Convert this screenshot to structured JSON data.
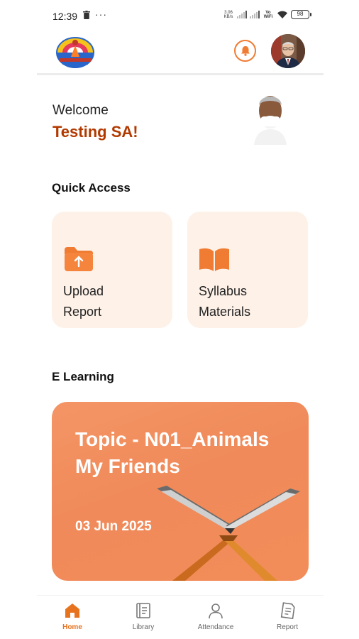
{
  "status_bar": {
    "time": "12:39",
    "more": "···",
    "net_speed_top": "3.06",
    "net_speed_bottom": "KB/s",
    "volte_top": "Vo",
    "volte_bottom": "WiFi",
    "battery": "98"
  },
  "header": {
    "logo_icon": "school-logo",
    "bell_icon": "bell-icon",
    "avatar": "profile-avatar"
  },
  "welcome": {
    "greeting": "Welcome",
    "name": "Testing SA!"
  },
  "quick_access": {
    "title": "Quick Access",
    "items": [
      {
        "line1": "Upload",
        "line2": "Report",
        "icon": "folder-upload-icon"
      },
      {
        "line1": "Syllabus",
        "line2": "Materials",
        "icon": "open-book-icon"
      }
    ]
  },
  "e_learning": {
    "title": "E Learning",
    "topic_line1": "Topic - N01_Animals",
    "topic_line2": "My Friends",
    "date": "03 Jun 2025"
  },
  "bottom_nav": {
    "items": [
      {
        "label": "Home",
        "icon": "home-icon",
        "active": true
      },
      {
        "label": "Library",
        "icon": "library-icon",
        "active": false
      },
      {
        "label": "Attendance",
        "icon": "person-icon",
        "active": false
      },
      {
        "label": "Report",
        "icon": "report-icon",
        "active": false
      }
    ]
  },
  "colors": {
    "accent": "#e8731f",
    "name_color": "#b23a00",
    "card_bg": "#fdf1e8",
    "elearning_bg": "#f08a5a"
  }
}
